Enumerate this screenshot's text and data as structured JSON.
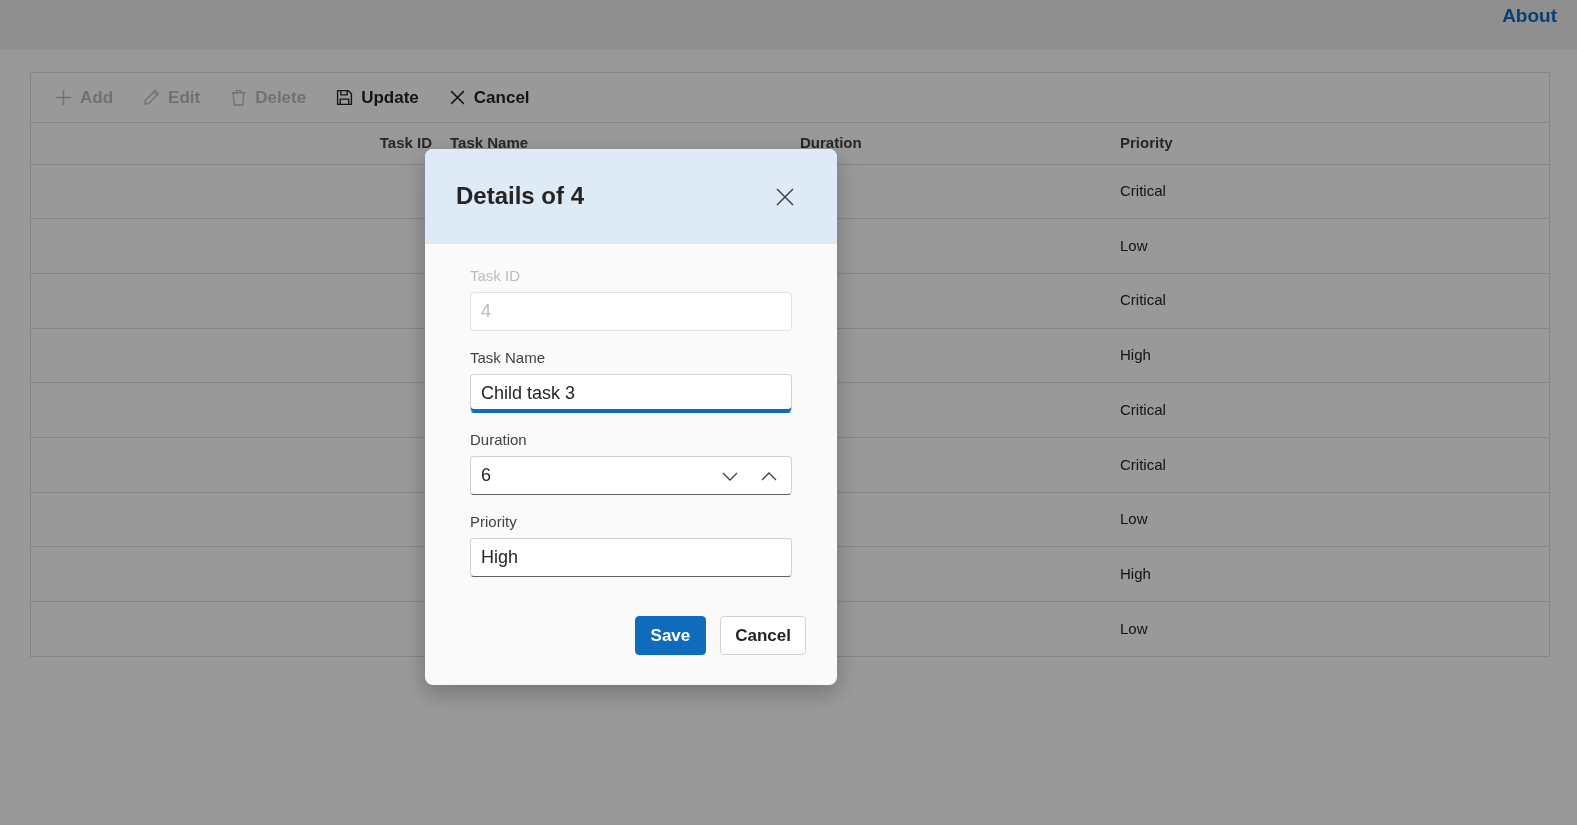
{
  "header": {
    "links": [
      {
        "label": "About"
      }
    ]
  },
  "toolbar": {
    "items": [
      {
        "label": "Add",
        "kind": "add",
        "disabled": true
      },
      {
        "label": "Edit",
        "kind": "edit",
        "disabled": true
      },
      {
        "label": "Delete",
        "kind": "delete",
        "disabled": true
      },
      {
        "label": "Update",
        "kind": "update",
        "disabled": false
      },
      {
        "label": "Cancel",
        "kind": "cancel",
        "disabled": false
      }
    ]
  },
  "grid": {
    "columns": [
      "Task ID",
      "Task Name",
      "Duration",
      "Priority"
    ],
    "rows": [
      {
        "priority": "Critical"
      },
      {
        "priority": "Low"
      },
      {
        "priority": "Critical"
      },
      {
        "priority": "High"
      },
      {
        "priority": "Critical"
      },
      {
        "priority": "Critical"
      },
      {
        "priority": "Low"
      },
      {
        "priority": "High"
      },
      {
        "priority": "Low"
      }
    ]
  },
  "dialog": {
    "title": "Details of 4",
    "fields": [
      {
        "label": "Task ID",
        "kind": "text",
        "value": "4",
        "disabled": true,
        "focused": false
      },
      {
        "label": "Task Name",
        "kind": "text",
        "value": "Child task 3",
        "disabled": false,
        "focused": true
      },
      {
        "label": "Duration",
        "kind": "numeric",
        "value": "6",
        "disabled": false,
        "focused": false
      },
      {
        "label": "Priority",
        "kind": "text",
        "value": "High",
        "disabled": false,
        "focused": false
      }
    ],
    "buttons": [
      {
        "label": "Save",
        "kind": "primary"
      },
      {
        "label": "Cancel",
        "kind": "secondary"
      }
    ]
  }
}
